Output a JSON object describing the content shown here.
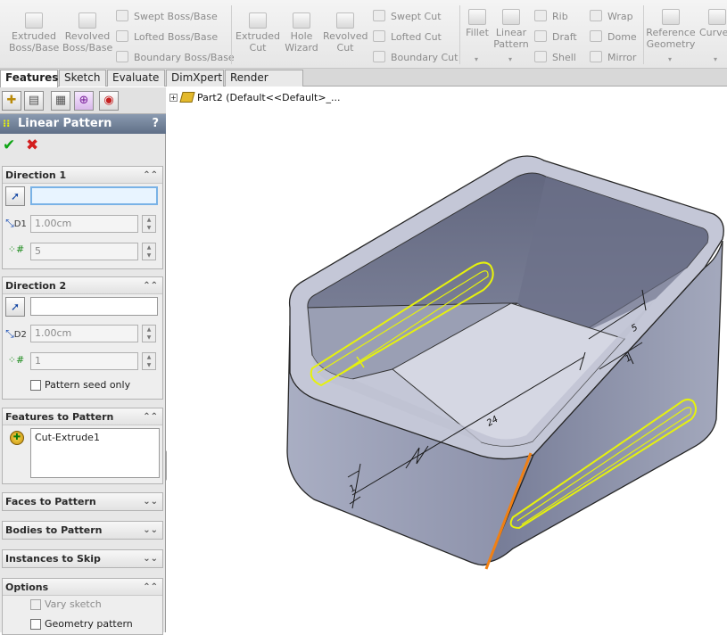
{
  "toolbar": {
    "extruded_boss": [
      "Extruded",
      "Boss/Base"
    ],
    "revolved_boss": [
      "Revolved",
      "Boss/Base"
    ],
    "swept_boss": "Swept Boss/Base",
    "lofted_boss": "Lofted Boss/Base",
    "boundary_boss": "Boundary Boss/Base",
    "extruded_cut": [
      "Extruded",
      "Cut"
    ],
    "hole_wizard": [
      "Hole",
      "Wizard"
    ],
    "revolved_cut": [
      "Revolved",
      "Cut"
    ],
    "swept_cut": "Swept Cut",
    "lofted_cut": "Lofted Cut",
    "boundary_cut": "Boundary Cut",
    "fillet": "Fillet",
    "linear_pattern": [
      "Linear",
      "Pattern"
    ],
    "rib": "Rib",
    "draft": "Draft",
    "shell": "Shell",
    "wrap": "Wrap",
    "dome": "Dome",
    "mirror": "Mirror",
    "reference_geometry": [
      "Reference",
      "Geometry"
    ],
    "curves": "Curves"
  },
  "tabs": [
    "Features",
    "Sketch",
    "Evaluate",
    "DimXpert",
    "Render Tools"
  ],
  "panel": {
    "title": "Linear Pattern",
    "help": "?",
    "direction1": {
      "header": "Direction 1",
      "distance": "1.00cm",
      "distance_icon": "D1",
      "instances": "5"
    },
    "direction2": {
      "header": "Direction 2",
      "distance": "1.00cm",
      "distance_icon": "D2",
      "instances": "1",
      "seed_only": "Pattern seed only"
    },
    "features": {
      "header": "Features to Pattern",
      "items": [
        "Cut-Extrude1"
      ]
    },
    "faces_header": "Faces to Pattern",
    "bodies_header": "Bodies to Pattern",
    "skip_header": "Instances to Skip",
    "options": {
      "header": "Options",
      "vary_sketch": "Vary sketch",
      "geometry_pattern": "Geometry pattern"
    }
  },
  "tree": {
    "part": "Part2  (Default<<Default>_..."
  },
  "model": {
    "dim_length": "24",
    "dim_spacing": "5",
    "dim_small": "1",
    "dim_small2": "1"
  },
  "colors": {
    "selection": "#e6f20c",
    "direction_edge": "#f08014",
    "panel_title": "#6c7b92",
    "ok": "#0ea514",
    "cancel": "#d31e1e"
  }
}
